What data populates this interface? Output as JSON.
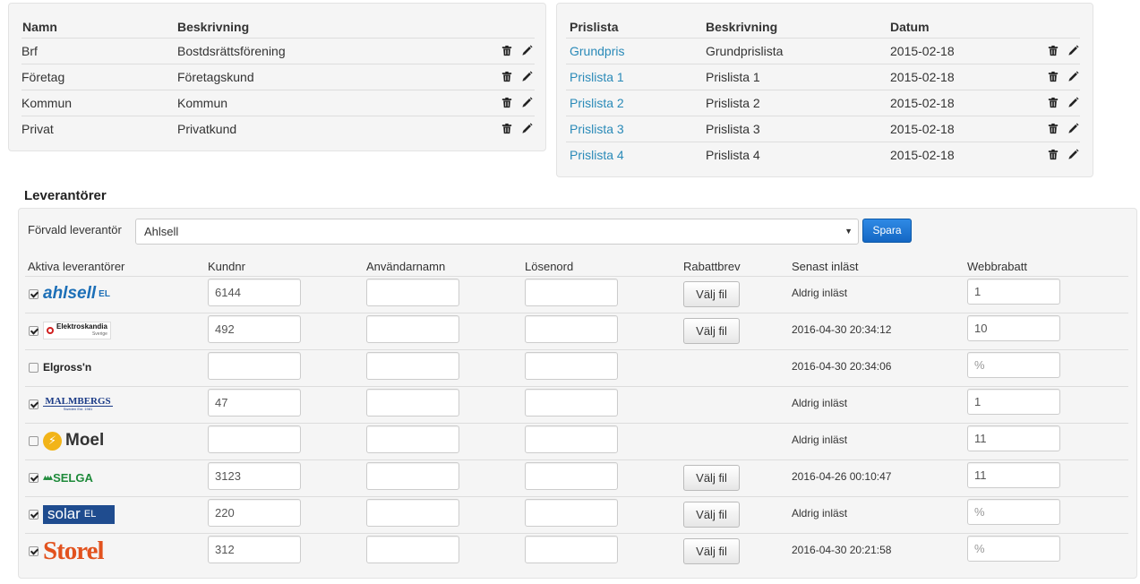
{
  "kundtyper": {
    "headers": [
      "Namn",
      "Beskrivning"
    ],
    "rows": [
      {
        "namn": "Brf",
        "beskrivning": "Bostdsrättsförening"
      },
      {
        "namn": "Företag",
        "beskrivning": "Företagskund"
      },
      {
        "namn": "Kommun",
        "beskrivning": "Kommun"
      },
      {
        "namn": "Privat",
        "beskrivning": "Privatkund"
      }
    ]
  },
  "prislistor": {
    "headers": [
      "Prislista",
      "Beskrivning",
      "Datum"
    ],
    "rows": [
      {
        "namn": "Grundpris",
        "beskrivning": "Grundprislista",
        "datum": "2015-02-18"
      },
      {
        "namn": "Prislista 1",
        "beskrivning": "Prislista 1",
        "datum": "2015-02-18"
      },
      {
        "namn": "Prislista 2",
        "beskrivning": "Prislista 2",
        "datum": "2015-02-18"
      },
      {
        "namn": "Prislista 3",
        "beskrivning": "Prislista 3",
        "datum": "2015-02-18"
      },
      {
        "namn": "Prislista 4",
        "beskrivning": "Prislista 4",
        "datum": "2015-02-18"
      }
    ]
  },
  "leverantorer": {
    "title": "Leverantörer",
    "default_label": "Förvald leverantör",
    "default_value": "Ahlsell",
    "save_label": "Spara",
    "headers": [
      "Aktiva leverantörer",
      "Kundnr",
      "Användarnamn",
      "Lösenord",
      "Rabattbrev",
      "Senast inläst",
      "Webbrabatt"
    ],
    "file_button_label": "Välj fil",
    "percent_placeholder": "%",
    "rows": [
      {
        "logo": "ahlsell",
        "logo_text": "ahlsell",
        "logo_sub": "EL",
        "checked": true,
        "kundnr": "6144",
        "has_file": true,
        "senast": "Aldrig inläst",
        "webbrabatt": "1"
      },
      {
        "logo": "elektroskandia",
        "logo_text": "Elektroskandia",
        "logo_sub": "Sverige",
        "checked": true,
        "kundnr": "492",
        "has_file": true,
        "senast": "2016-04-30 20:34:12",
        "webbrabatt": "10"
      },
      {
        "logo": "elgrossn",
        "logo_text": "Elgross'n",
        "logo_sub": "",
        "checked": false,
        "kundnr": "",
        "has_file": false,
        "senast": "2016-04-30 20:34:06",
        "webbrabatt": ""
      },
      {
        "logo": "malmbergs",
        "logo_text": "MALMBERGS",
        "logo_sub": "Sweden Est. 1981",
        "checked": true,
        "kundnr": "47",
        "has_file": false,
        "senast": "Aldrig inläst",
        "webbrabatt": "1"
      },
      {
        "logo": "moel",
        "logo_text": "Moel",
        "logo_sub": "",
        "checked": false,
        "kundnr": "",
        "has_file": false,
        "senast": "Aldrig inläst",
        "webbrabatt": "11"
      },
      {
        "logo": "selga",
        "logo_text": "SELGA",
        "logo_sub": "",
        "checked": true,
        "kundnr": "3123",
        "has_file": true,
        "senast": "2016-04-26 00:10:47",
        "webbrabatt": "11"
      },
      {
        "logo": "solar",
        "logo_text": "solar",
        "logo_sub": "EL",
        "checked": true,
        "kundnr": "220",
        "has_file": true,
        "senast": "Aldrig inläst",
        "webbrabatt": ""
      },
      {
        "logo": "storel",
        "logo_text": "Storel",
        "logo_sub": "",
        "checked": true,
        "kundnr": "312",
        "has_file": true,
        "senast": "2016-04-30 20:21:58",
        "webbrabatt": ""
      }
    ]
  },
  "colors": {
    "link": "#2a8ab8",
    "primary_button": "#1877d2",
    "panel_bg": "#f5f5f5"
  }
}
